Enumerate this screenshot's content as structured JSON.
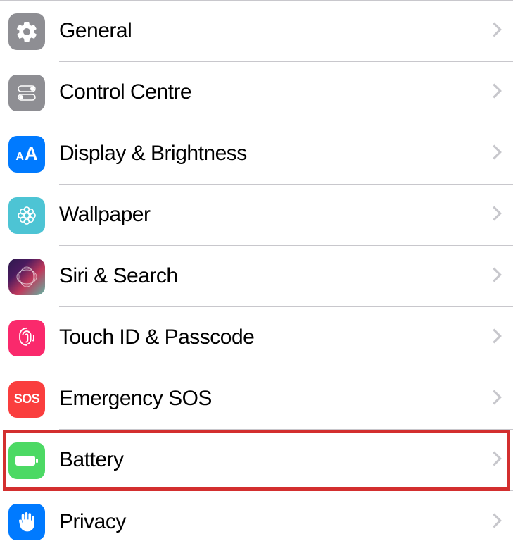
{
  "settings": {
    "items": [
      {
        "label": "General",
        "icon": "gear-icon",
        "bg": "icon-general"
      },
      {
        "label": "Control Centre",
        "icon": "switches-icon",
        "bg": "icon-control"
      },
      {
        "label": "Display & Brightness",
        "icon": "text-size-icon",
        "bg": "icon-display"
      },
      {
        "label": "Wallpaper",
        "icon": "flower-icon",
        "bg": "icon-wallpaper"
      },
      {
        "label": "Siri & Search",
        "icon": "siri-icon",
        "bg": "icon-siri"
      },
      {
        "label": "Touch ID & Passcode",
        "icon": "fingerprint-icon",
        "bg": "icon-touchid"
      },
      {
        "label": "Emergency SOS",
        "icon": "sos-icon",
        "bg": "icon-sos"
      },
      {
        "label": "Battery",
        "icon": "battery-icon",
        "bg": "icon-battery",
        "highlighted": true
      },
      {
        "label": "Privacy",
        "icon": "hand-icon",
        "bg": "icon-privacy"
      }
    ]
  }
}
